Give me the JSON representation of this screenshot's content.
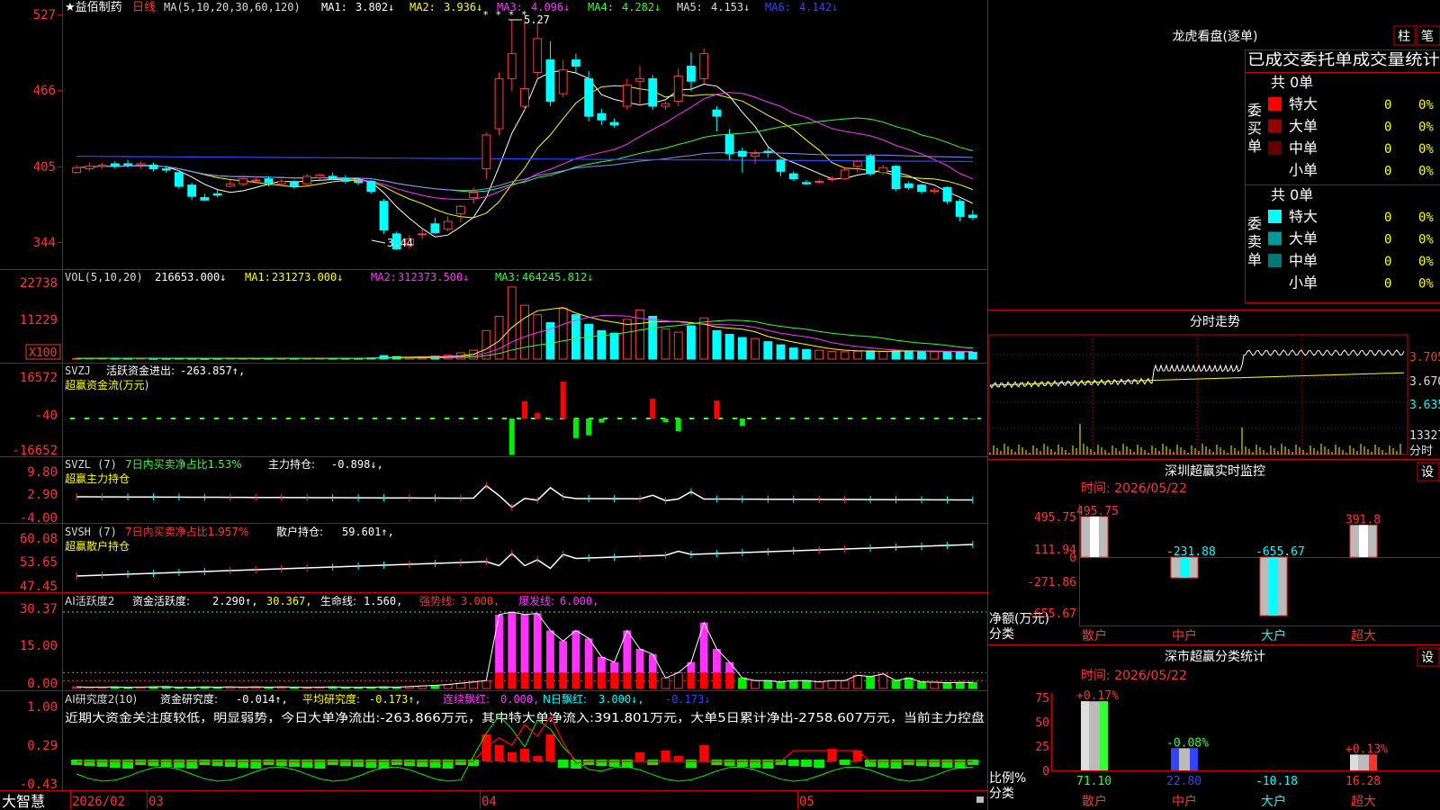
{
  "app": {
    "brand": "大智慧",
    "stock_name": "★益佰制药",
    "period": "日线"
  },
  "colors": {
    "up": "#ff3b3b",
    "down": "#00ffff",
    "ma1": "#ffffff",
    "ma2": "#ffff00",
    "ma3": "#ff33ff",
    "ma4": "#33ff33",
    "ma5": "#8a8aff",
    "ma6": "#3344ff",
    "grid_red": "#cc0000",
    "axis_text": "#ff3333"
  },
  "kline": {
    "ma_header": "MA(5,10,20,30,60,120)",
    "ma_values": [
      {
        "label": "MA1:",
        "value": "3.802↓"
      },
      {
        "label": "MA2:",
        "value": "3.936↓"
      },
      {
        "label": "MA3:",
        "value": "4.096↓"
      },
      {
        "label": "MA4:",
        "value": "4.282↓"
      },
      {
        "label": "MA5:",
        "value": "4.153↓"
      },
      {
        "label": "MA6:",
        "value": "4.142↓"
      }
    ],
    "yticks": [
      "527",
      "466",
      "405",
      "344"
    ],
    "high_label": "5.27",
    "low_label": "3.44"
  },
  "volume": {
    "header": "VOL(5,10,20)",
    "value": "216653.000↓",
    "ma_values": [
      {
        "label": "MA1:",
        "value": "231273.000↓"
      },
      {
        "label": "MA2:",
        "value": "312373.500↓"
      },
      {
        "label": "MA3:",
        "value": "464245.812↓"
      }
    ],
    "yticks": [
      "22738",
      "11229"
    ],
    "unit": "X100"
  },
  "svzj": {
    "header": "SVZJ",
    "label": "活跃资金进出:",
    "value": "-263.857↑,",
    "subtitle": "超赢资金流(万元)",
    "yticks": [
      "16572",
      "-40",
      "-16652"
    ]
  },
  "svzl": {
    "header": "SVZL (7)",
    "label1": "7日内买卖净占比1.53%",
    "label2": "主力持仓:",
    "value": "-0.898↓,",
    "subtitle": "超赢主力持仓",
    "yticks": [
      "9.80",
      "2.90",
      "-4.00"
    ]
  },
  "svsh": {
    "header": "SVSH (7)",
    "label1": "7日内买卖净占比1.957%",
    "label2": "散户持仓:",
    "value": "59.601↑,",
    "subtitle": "超赢散户持仓",
    "yticks": [
      "60.08",
      "53.65",
      "47.45"
    ]
  },
  "ai_active": {
    "header": "AI活跃度2",
    "label1": "资金活跃度:",
    "value1": "2.290↑,",
    "value2": "30.367,",
    "label3": "生命线:",
    "value3": "1.560,",
    "label4": "强势线:",
    "value4": "3.000,",
    "label5": "爆发线:",
    "value5": "6.000,",
    "yticks": [
      "30.37",
      "15.00",
      "0.00"
    ]
  },
  "ai_research": {
    "header": "AI研究度2(10)",
    "label1": "资金研究度:",
    "value1": "-0.014↑,",
    "label2": "平均研究度:",
    "value2": "-0.173↑,",
    "label3": "连续飘红:",
    "value3": "0.000,",
    "label4": "N日飘红:",
    "value4": "3.000↓,",
    "value5": "-0.173↓",
    "comment": "近期大资金关注度较低，明显弱势，今日大单净流出:-263.866万元，其中特大单净流入:391.801万元，大单5日累计净出-2758.607万元，当前主力控盘",
    "yticks": [
      "1.00",
      "0.29",
      "-0.43"
    ]
  },
  "date_axis": {
    "labels": [
      "2026/02",
      "03",
      "04",
      "05"
    ]
  },
  "dragon": {
    "title": "龙虎看盘(逐单)",
    "btn_bar": "柱",
    "btn_tick": "笔",
    "tabs": "已成交委托单成交量统计",
    "buy": {
      "side_label": "委买单",
      "total": "共 0单",
      "rows": [
        {
          "name": "特大",
          "count": "0",
          "pct": "0%",
          "color": "#ff0000"
        },
        {
          "name": "大单",
          "count": "0",
          "pct": "0%",
          "color": "#990000"
        },
        {
          "name": "中单",
          "count": "0",
          "pct": "0%",
          "color": "#660000"
        },
        {
          "name": "小单",
          "count": "0",
          "pct": "0%",
          "color": ""
        }
      ]
    },
    "sell": {
      "side_label": "委卖单",
      "total": "共 0单",
      "rows": [
        {
          "name": "特大",
          "count": "0",
          "pct": "0%",
          "color": "#00ffff"
        },
        {
          "name": "大单",
          "count": "0",
          "pct": "0%",
          "color": "#009999"
        },
        {
          "name": "中单",
          "count": "0",
          "pct": "0%",
          "color": "#007777"
        },
        {
          "name": "小单",
          "count": "0",
          "pct": "0%",
          "color": ""
        }
      ]
    }
  },
  "intraday": {
    "title": "分时走势",
    "yticks": [
      "3.705",
      "3.670",
      "3.635"
    ],
    "vol_label": "13327",
    "footer": "分时"
  },
  "sz_monitor": {
    "title": "深圳超赢实时监控",
    "settings": "设",
    "time": "时间: 2026/05/22",
    "yticks": [
      "495.75",
      "111.94",
      "0",
      "-271.86",
      "-655.67"
    ],
    "ylabel": "净额(万元)",
    "xlabel": "分类",
    "categories": [
      "散户",
      "中户",
      "大户",
      "超大"
    ],
    "bar_labels": [
      "495.75",
      "-231.88",
      "-655.67",
      "391.8"
    ]
  },
  "sz_class": {
    "title": "深市超赢分类统计",
    "settings": "设",
    "time": "时间: 2026/05/22",
    "yticks": [
      "75",
      "50",
      "25",
      "0"
    ],
    "ylabel": "比例%",
    "xlabel": "分类",
    "categories": [
      "散户",
      "中户",
      "大户",
      "超大"
    ],
    "bar_top_labels": [
      "+0.17%",
      "-0.08%",
      "",
      "+0.13%"
    ],
    "bar_bottom_labels": [
      "71.10",
      "22.80",
      "-10.18",
      "16.28"
    ]
  },
  "chart_data": [
    {
      "type": "candlestick",
      "title": "益佰制药 日线",
      "ylim": [
        3.3,
        5.4
      ],
      "candles": [
        [
          4.05,
          4.09,
          4.04,
          4.11
        ],
        [
          4.08,
          4.1,
          4.06,
          4.13
        ],
        [
          4.1,
          4.11,
          4.08,
          4.13
        ],
        [
          4.12,
          4.1,
          4.08,
          4.14
        ],
        [
          4.12,
          4.11,
          4.09,
          4.15
        ],
        [
          4.11,
          4.12,
          4.08,
          4.14
        ],
        [
          4.11,
          4.08,
          4.06,
          4.13
        ],
        [
          4.08,
          4.07,
          4.05,
          4.1
        ],
        [
          4.05,
          3.94,
          3.92,
          4.06
        ],
        [
          3.95,
          3.86,
          3.83,
          3.97
        ],
        [
          3.85,
          3.83,
          3.82,
          3.88
        ],
        [
          3.88,
          3.87,
          3.85,
          3.92
        ],
        [
          3.94,
          3.96,
          3.93,
          3.99
        ],
        [
          3.96,
          4.0,
          3.94,
          4.01
        ],
        [
          3.99,
          3.99,
          3.96,
          4.02
        ],
        [
          4.0,
          3.97,
          3.94,
          4.02
        ],
        [
          3.96,
          3.98,
          3.95,
          4.0
        ],
        [
          3.97,
          3.94,
          3.92,
          3.99
        ],
        [
          3.96,
          4.02,
          3.95,
          4.04
        ],
        [
          4.01,
          4.03,
          3.99,
          4.04
        ],
        [
          4.02,
          4.0,
          3.99,
          4.05
        ],
        [
          4.0,
          3.98,
          3.96,
          4.03
        ],
        [
          3.98,
          3.97,
          3.95,
          4.0
        ],
        [
          3.98,
          3.9,
          3.88,
          3.99
        ],
        [
          3.82,
          3.59,
          3.56,
          3.84
        ],
        [
          3.56,
          3.44,
          3.43,
          3.58
        ],
        [
          3.47,
          3.52,
          3.44,
          3.55
        ],
        [
          3.56,
          3.56,
          3.52,
          3.6
        ],
        [
          3.64,
          3.57,
          3.56,
          3.69
        ],
        [
          3.6,
          3.66,
          3.58,
          3.7
        ],
        [
          3.72,
          3.78,
          3.65,
          3.79
        ],
        [
          3.85,
          3.89,
          3.8,
          3.93
        ],
        [
          4.08,
          4.35,
          4.0,
          4.37
        ],
        [
          4.4,
          4.8,
          4.35,
          4.85
        ],
        [
          4.8,
          5.0,
          4.7,
          5.27
        ],
        [
          4.58,
          4.72,
          4.55,
          5.27
        ],
        [
          4.85,
          5.12,
          4.8,
          5.25
        ],
        [
          4.95,
          4.62,
          4.58,
          5.1
        ],
        [
          4.68,
          4.87,
          4.65,
          4.95
        ],
        [
          4.95,
          4.9,
          4.85,
          5.0
        ],
        [
          4.8,
          4.5,
          4.46,
          4.86
        ],
        [
          4.52,
          4.47,
          4.43,
          4.56
        ],
        [
          4.45,
          4.43,
          4.41,
          4.48
        ],
        [
          4.58,
          4.75,
          4.55,
          4.8
        ],
        [
          4.78,
          4.8,
          4.58,
          4.9
        ],
        [
          4.8,
          4.58,
          4.55,
          4.83
        ],
        [
          4.58,
          4.6,
          4.55,
          4.62
        ],
        [
          4.62,
          4.82,
          4.58,
          4.88
        ],
        [
          4.9,
          4.78,
          4.7,
          5.01
        ],
        [
          4.8,
          5.0,
          4.76,
          5.04
        ],
        [
          4.55,
          4.5,
          4.38,
          4.58
        ],
        [
          4.35,
          4.2,
          4.15,
          4.4
        ],
        [
          4.22,
          4.18,
          4.05,
          4.25
        ],
        [
          4.18,
          4.2,
          4.12,
          4.23
        ],
        [
          4.22,
          4.21,
          4.17,
          4.25
        ],
        [
          4.15,
          4.06,
          4.02,
          4.16
        ],
        [
          4.04,
          4.0,
          3.98,
          4.06
        ],
        [
          3.97,
          3.96,
          3.95,
          3.99
        ],
        [
          3.98,
          3.98,
          3.96,
          4.0
        ],
        [
          4.0,
          4.0,
          3.98,
          4.02
        ],
        [
          4.0,
          4.07,
          3.99,
          4.09
        ],
        [
          4.1,
          4.14,
          4.05,
          4.15
        ],
        [
          4.18,
          4.04,
          4.02,
          4.2
        ],
        [
          4.05,
          4.09,
          4.03,
          4.11
        ],
        [
          4.1,
          3.92,
          3.9,
          4.11
        ],
        [
          3.96,
          3.93,
          3.91,
          3.98
        ],
        [
          3.95,
          3.9,
          3.88,
          3.96
        ],
        [
          3.9,
          3.91,
          3.88,
          3.93
        ],
        [
          3.93,
          3.82,
          3.8,
          3.94
        ],
        [
          3.82,
          3.7,
          3.66,
          3.84
        ],
        [
          3.71,
          3.69,
          3.67,
          3.75
        ]
      ],
      "ma5_level": 3.8
    },
    {
      "type": "bar",
      "title": "VOL(5,10,20)",
      "ylim": [
        0,
        23000
      ],
      "values": [
        220,
        280,
        300,
        280,
        260,
        300,
        220,
        240,
        280,
        260,
        200,
        240,
        260,
        240,
        250,
        260,
        230,
        260,
        240,
        260,
        270,
        260,
        250,
        400,
        1100,
        800,
        500,
        700,
        900,
        1200,
        2000,
        2800,
        9000,
        13500,
        22738,
        17000,
        14000,
        11500,
        16000,
        14000,
        11000,
        9000,
        8200,
        12500,
        15500,
        13500,
        9500,
        8500,
        10500,
        13000,
        9000,
        7800,
        6800,
        6500,
        5500,
        4500,
        3500,
        3000,
        2800,
        2400,
        2300,
        2500,
        2600,
        2400,
        2600,
        2700,
        2400,
        2300,
        2200,
        2300,
        2166
      ]
    },
    {
      "type": "bar",
      "title": "超赢资金流(万元)",
      "ylim": [
        -16652,
        16572
      ],
      "values": [
        0,
        0,
        0,
        0,
        0,
        0,
        0,
        0,
        0,
        0,
        0,
        0,
        0,
        0,
        0,
        0,
        0,
        0,
        0,
        0,
        0,
        0,
        0,
        0,
        0,
        0,
        0,
        0,
        0,
        0,
        0,
        0,
        0,
        0,
        -16000,
        7500,
        2500,
        -600,
        16200,
        -8600,
        -7400,
        -1800,
        0,
        0,
        0,
        8700,
        -1600,
        -5600,
        0,
        0,
        7900,
        0,
        -3200,
        0,
        0,
        0,
        0,
        0,
        0,
        0,
        0,
        0,
        0,
        0,
        0,
        0,
        0,
        0,
        0,
        0,
        -263
      ]
    },
    {
      "type": "bar",
      "title": "AI活跃度2",
      "ylim": [
        0,
        30.37
      ],
      "values": [
        0.6,
        0.5,
        0.5,
        0.6,
        0.4,
        0.5,
        0.6,
        0.7,
        0.4,
        0.5,
        0.6,
        0.5,
        0.6,
        0.5,
        0.6,
        0.5,
        0.6,
        0.5,
        0.4,
        0.5,
        0.6,
        0.5,
        0.4,
        0.5,
        0.6,
        0.5,
        0.7,
        1.0,
        1.2,
        1.5,
        2.0,
        2.5,
        3.0,
        28,
        29,
        28,
        28.5,
        22,
        18,
        22,
        19,
        12,
        10,
        22,
        15,
        13,
        4,
        6,
        10,
        25,
        15,
        10,
        4,
        3,
        3,
        2.5,
        3,
        3,
        2.5,
        3,
        3,
        5,
        4.5,
        5.5,
        3,
        4,
        2.5,
        2.4,
        2.2,
        2.3,
        2.29
      ]
    },
    {
      "type": "bar",
      "title": "深圳超赢实时监控",
      "categories": [
        "散户",
        "中户",
        "大户",
        "超大"
      ],
      "values": [
        495.75,
        -231.88,
        -655.67,
        391.8
      ],
      "ylim": [
        -655.67,
        495.75
      ],
      "xlabel": "分类",
      "ylabel": "净额(万元)"
    },
    {
      "type": "bar",
      "title": "深市超赢分类统计",
      "categories": [
        "散户",
        "中户",
        "大户",
        "超大"
      ],
      "values": [
        71.1,
        22.8,
        -10.18,
        16.28
      ],
      "ylim": [
        0,
        75
      ],
      "xlabel": "分类",
      "ylabel": "比例%"
    }
  ]
}
